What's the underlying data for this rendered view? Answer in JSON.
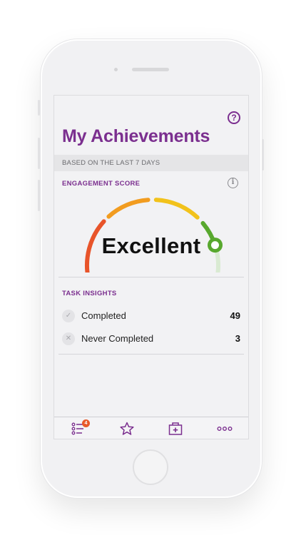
{
  "header": {
    "title": "My Achievements",
    "help_icon": "question-mark-icon",
    "help_glyph": "?"
  },
  "period": {
    "label": "BASED ON THE LAST 7 DAYS"
  },
  "engagement": {
    "section_label": "ENGAGEMENT SCORE",
    "info_glyph": "i",
    "rating": "Excellent",
    "gauge_colors": [
      "#e8542a",
      "#f29c1f",
      "#f2c21b",
      "#58a82e"
    ],
    "gauge_track_color": "#d9ead2"
  },
  "task_insights": {
    "section_label": "TASK INSIGHTS",
    "rows": [
      {
        "label": "Completed",
        "value": "49",
        "icon": "checkmark-icon",
        "glyph": "✓"
      },
      {
        "label": "Never Completed",
        "value": "3",
        "icon": "x-icon",
        "glyph": "✕"
      }
    ]
  },
  "tabbar": {
    "items": [
      {
        "name": "tasks-list-icon",
        "badge": "4"
      },
      {
        "name": "star-icon"
      },
      {
        "name": "medical-kit-icon"
      },
      {
        "name": "more-dots-icon"
      }
    ]
  },
  "colors": {
    "brand": "#7b2f8f",
    "badge": "#e85a2a"
  }
}
